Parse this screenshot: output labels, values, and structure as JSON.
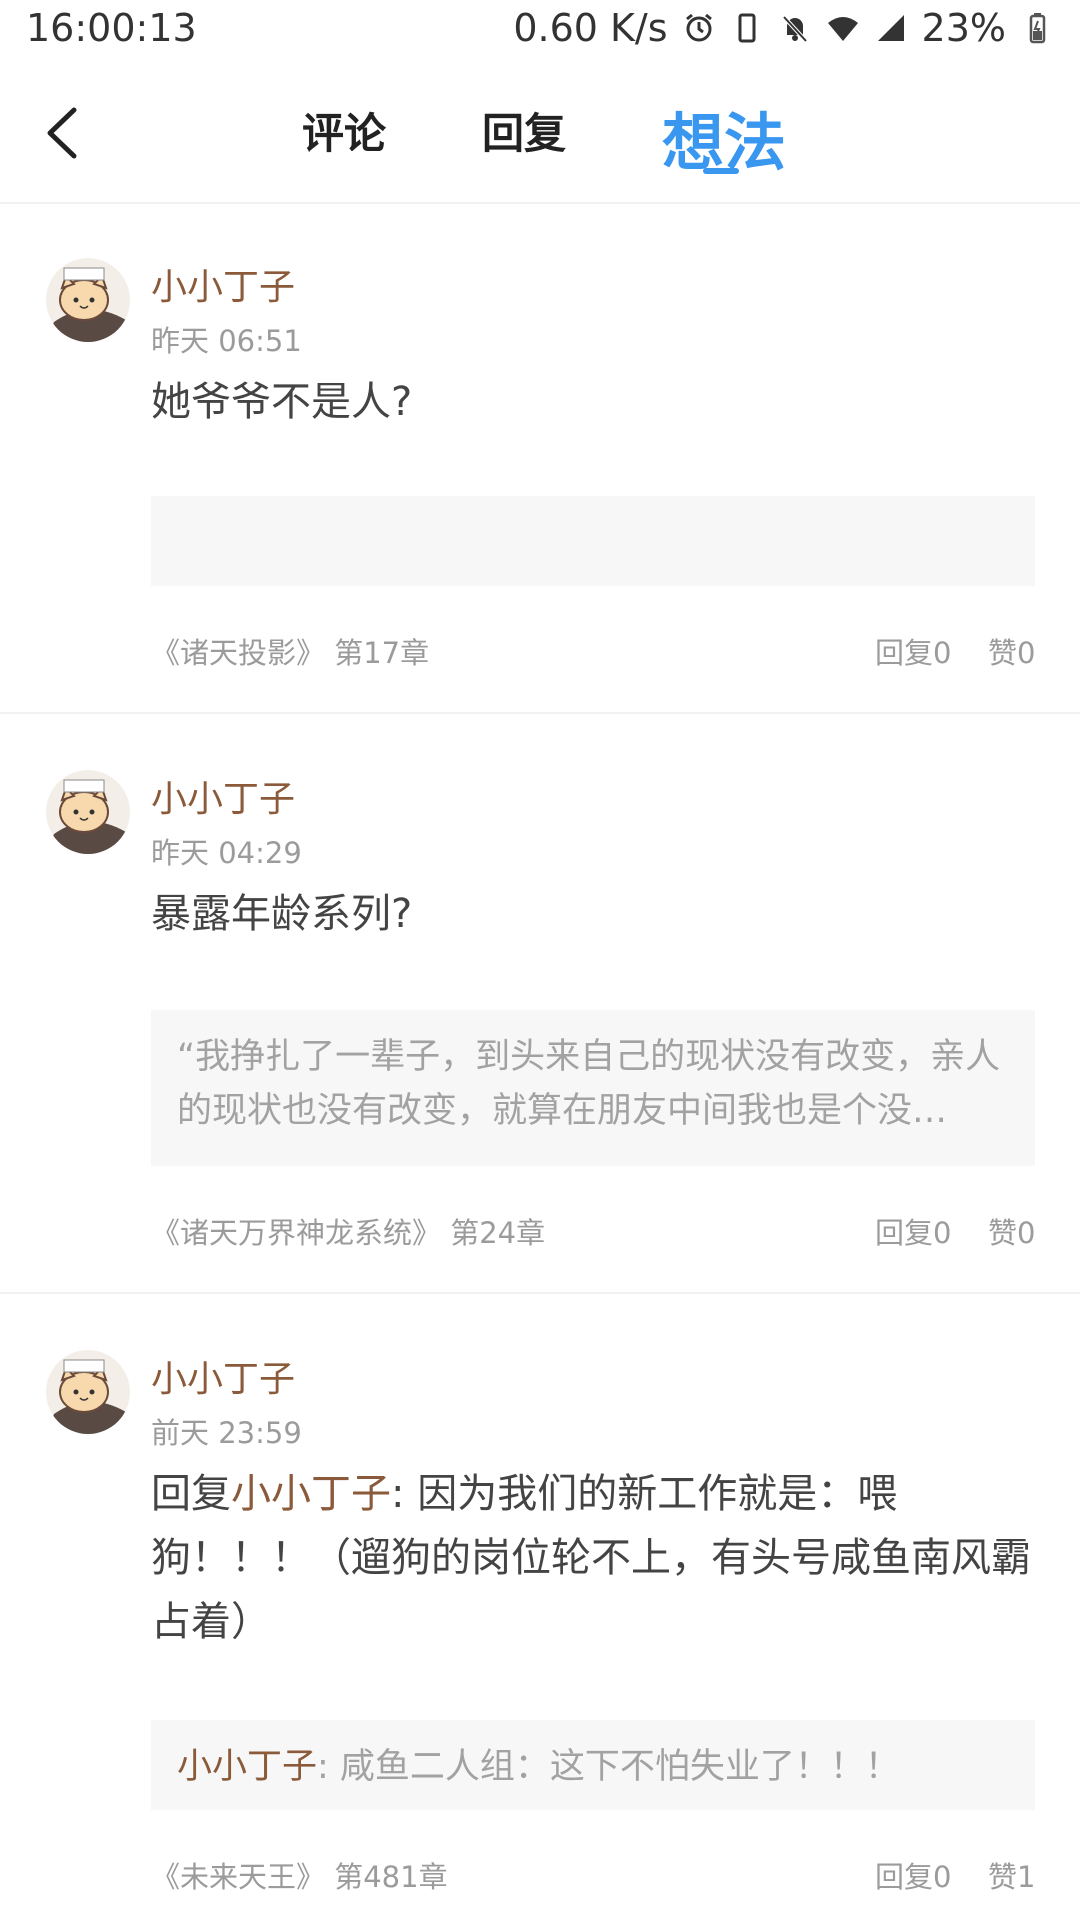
{
  "status_bar": {
    "time": "16:00:13",
    "network_speed": "0.60 K/s",
    "battery": "23%",
    "icons": [
      "alarm-icon",
      "phone-icon",
      "bell-off-icon",
      "wifi-icon",
      "signal-icon",
      "battery-icon"
    ]
  },
  "nav": {
    "tabs": [
      {
        "label": "评论"
      },
      {
        "label": "回复"
      },
      {
        "label": "想法"
      }
    ],
    "active_tab": "想法",
    "accent_color": "#3a97f0"
  },
  "posts": [
    {
      "username": "小小丁子",
      "time": "昨天 06:51",
      "content": "她爷爷不是人?",
      "quote": "",
      "book": "《诸天投影》 第17章",
      "replies": "回复0",
      "likes": "赞0"
    },
    {
      "username": "小小丁子",
      "time": "昨天 04:29",
      "content": "暴露年龄系列?",
      "quote": "“我挣扎了一辈子，到头来自己的现状没有改变，亲人的现状也没有改变，就算在朋友中间我也是个没…",
      "book": "《诸天万界神龙系统》 第24章",
      "replies": "回复0",
      "likes": "赞0"
    },
    {
      "username": "小小丁子",
      "time": "前天 23:59",
      "content_prefix": "回复",
      "content_mention": "小小丁子",
      "content": ": 因为我们的新工作就是：喂狗！！！（遛狗的岗位轮不上，有头号咸鱼南风霸占着）",
      "quote_mention": "小小丁子",
      "quote": ": 咸鱼二人组：这下不怕失业了！！！",
      "book": "《未来天王》 第481章",
      "replies": "回复0",
      "likes": "赞1"
    }
  ]
}
